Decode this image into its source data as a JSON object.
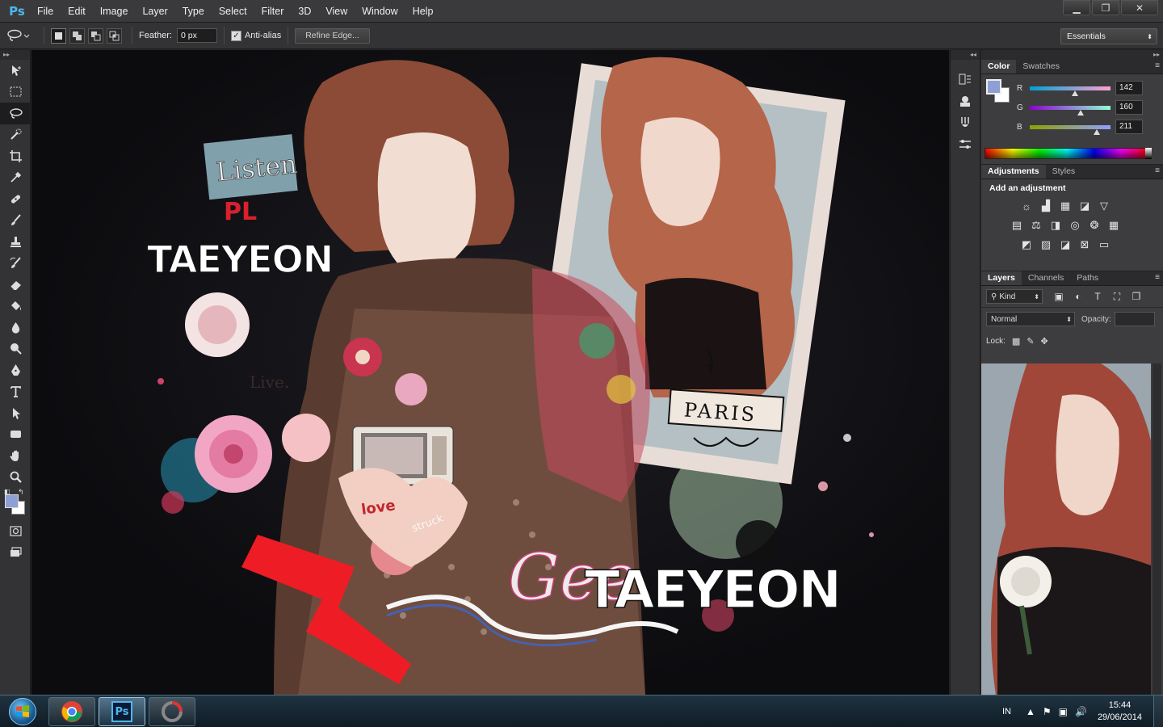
{
  "app": {
    "logo": "Ps",
    "menu": [
      "File",
      "Edit",
      "Image",
      "Layer",
      "Type",
      "Select",
      "Filter",
      "3D",
      "View",
      "Window",
      "Help"
    ],
    "window_controls": {
      "minimize": "▁",
      "restore": "❐",
      "close": "✕"
    }
  },
  "options_bar": {
    "tool_icon": "lasso-icon",
    "feather_label": "Feather:",
    "feather_value": "0 px",
    "antialias_label": "Anti-alias",
    "antialias_checked": true,
    "refine_edge_label": "Refine Edge...",
    "workspace": "Essentials"
  },
  "tools": [
    "move-tool-icon",
    "marquee-tool-icon",
    "lasso-tool-icon",
    "quick-selection-tool-icon",
    "crop-tool-icon",
    "eyedropper-tool-icon",
    "healing-brush-tool-icon",
    "brush-tool-icon",
    "clone-stamp-tool-icon",
    "history-brush-tool-icon",
    "eraser-tool-icon",
    "paint-bucket-tool-icon",
    "blur-tool-icon",
    "dodge-tool-icon",
    "pen-tool-icon",
    "type-tool-icon",
    "path-selection-tool-icon",
    "rectangle-tool-icon",
    "hand-tool-icon",
    "zoom-tool-icon"
  ],
  "colors": {
    "foreground": "#8ea0d3",
    "background": "#ffffff",
    "accent": "#4fb6f0"
  },
  "artwork": {
    "title_top": "TAEYEON",
    "title_bottom": "TAEYEON",
    "script_text": "Gee",
    "word_listen": "Listen",
    "word_play": "PL",
    "word_live": "Live.",
    "word_love": "love",
    "word_struck": "struck",
    "word_paris": "PARIS"
  },
  "color_panel": {
    "tabs": [
      "Color",
      "Swatches"
    ],
    "channels": [
      {
        "label": "R",
        "value": "142",
        "fraction": 0.557
      },
      {
        "label": "G",
        "value": "160",
        "fraction": 0.627
      },
      {
        "label": "B",
        "value": "211",
        "fraction": 0.827
      }
    ]
  },
  "adjustments_panel": {
    "tabs": [
      "Adjustments",
      "Styles"
    ],
    "hint": "Add an adjustment"
  },
  "layers_panel": {
    "tabs": [
      "Layers",
      "Channels",
      "Paths"
    ],
    "filter_kind": "Kind",
    "blend_mode": "Normal",
    "opacity_label": "Opacity:",
    "lock_label": "Lock:"
  },
  "taskbar": {
    "language": "IN",
    "time": "15:44",
    "date": "29/06/2014",
    "apps": [
      "chrome-icon",
      "photoshop-icon",
      "app-icon"
    ]
  }
}
